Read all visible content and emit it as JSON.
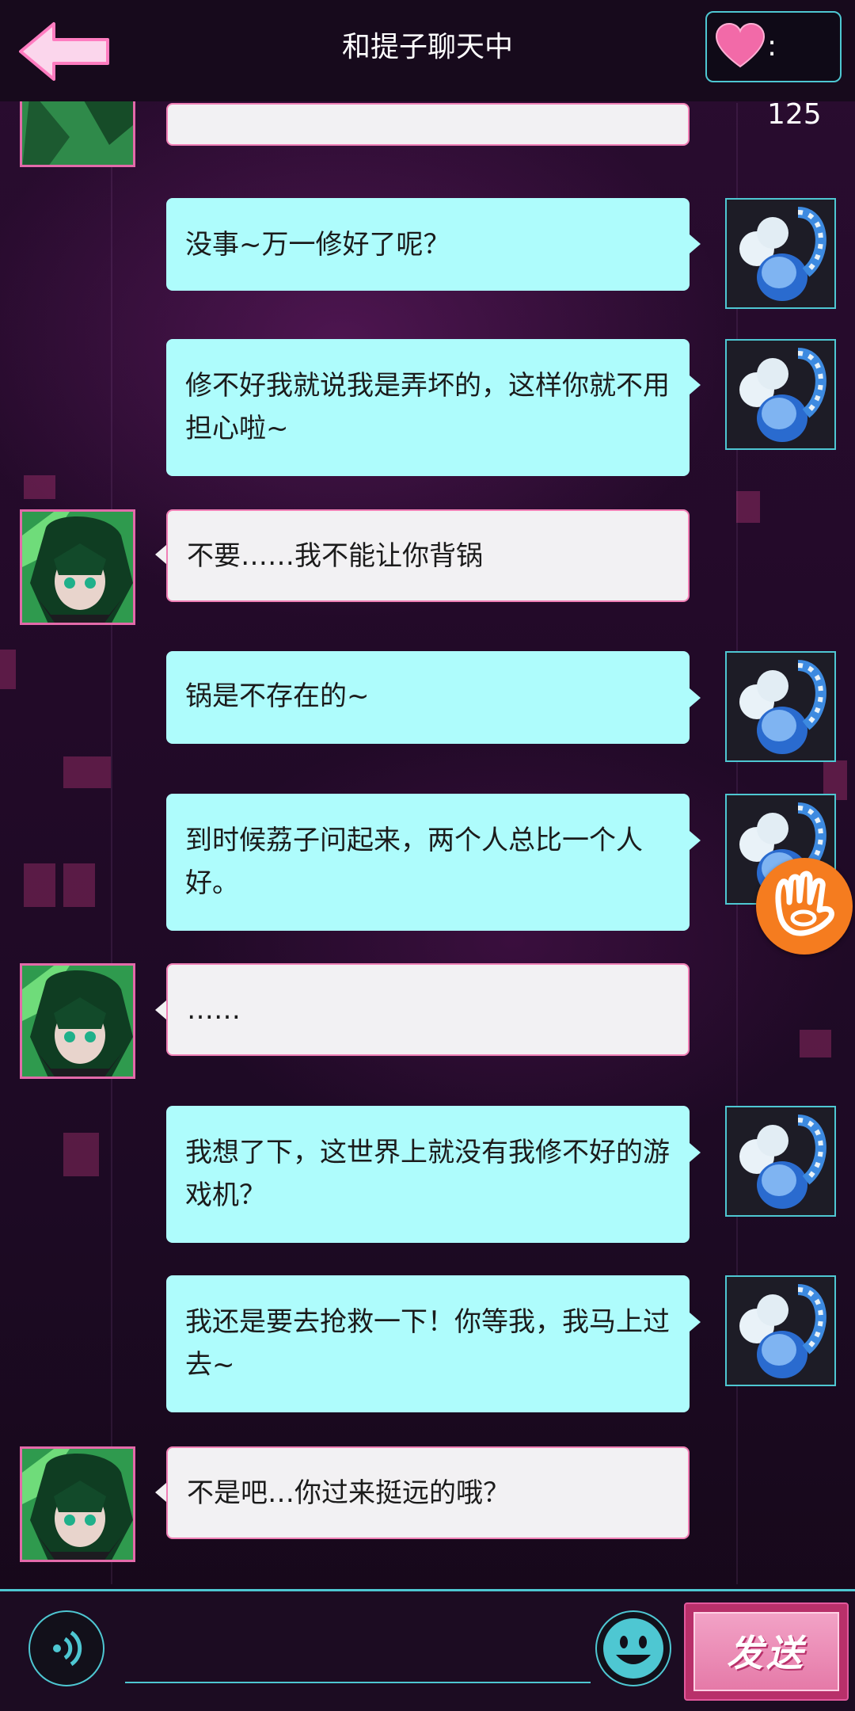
{
  "header": {
    "title": "和提子聊天中",
    "heart_count": ": 125"
  },
  "messages": [
    {
      "sender": "other",
      "text": ""
    },
    {
      "sender": "me",
      "text": "没事~万一修好了呢？"
    },
    {
      "sender": "me",
      "text": "修不好我就说我是弄坏的，这样你就不用担心啦~"
    },
    {
      "sender": "other",
      "text": "不要……我不能让你背锅"
    },
    {
      "sender": "me",
      "text": "锅是不存在的~"
    },
    {
      "sender": "me",
      "text": "到时候荔子问起来，两个人总比一个人好。"
    },
    {
      "sender": "other",
      "text": "……"
    },
    {
      "sender": "me",
      "text": "我想了下，这世界上就没有我修不好的游戏机？"
    },
    {
      "sender": "me",
      "text": "我还是要去抢救一下！你等我，我马上过去~"
    },
    {
      "sender": "other",
      "text": "不是吧…你过来挺远的哦？"
    }
  ],
  "input": {
    "placeholder": ""
  },
  "send_button": {
    "label": "发送"
  },
  "colors": {
    "accent_cyan": "#4ec7d2",
    "bubble_me": "#aefcfc",
    "bubble_other": "#f2f1f3",
    "pink": "#e36aaa",
    "heart": "#f26aa8"
  },
  "icons": {
    "back": "back-arrow-icon",
    "heart": "heart-icon",
    "voice": "voice-icon",
    "emoji": "smiley-icon",
    "float": "hand-logo-icon"
  }
}
